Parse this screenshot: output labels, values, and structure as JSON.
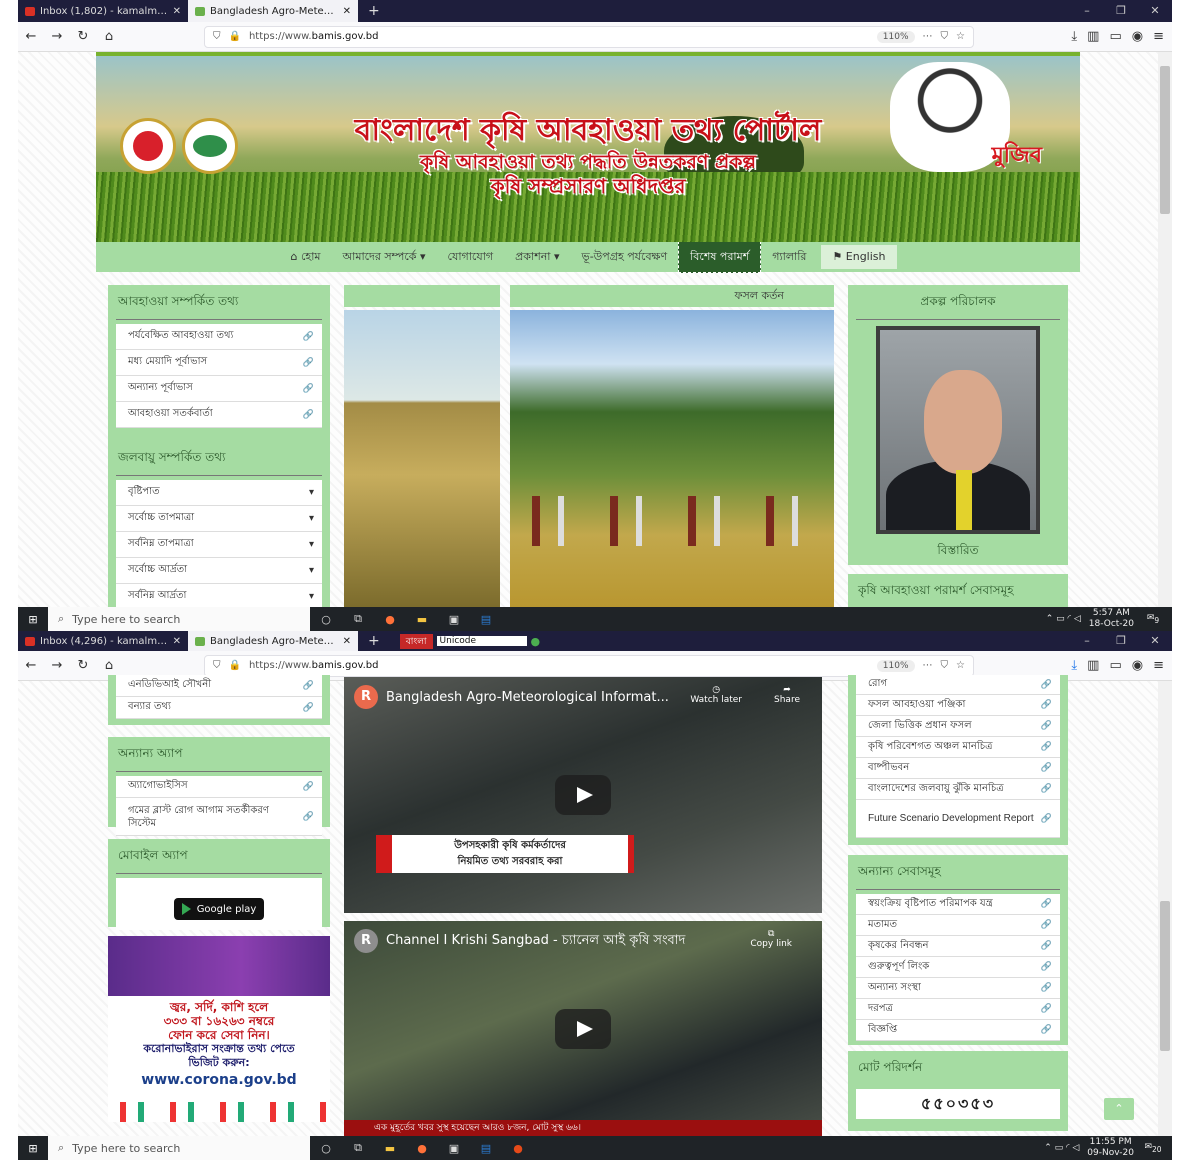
{
  "shot1": {
    "tabs": [
      {
        "title": "Inbox (1,802) - kamalmoa@gm",
        "close": "✕"
      },
      {
        "title": "Bangladesh Agro-Meteorolog",
        "close": "✕"
      }
    ],
    "new_tab": "+",
    "url_prefix": "https://www.",
    "url_domain": "bamis.gov.bd",
    "zoom": "110%",
    "banner": {
      "title": "বাংলাদেশ কৃষি আবহাওয়া তথ্য পোর্টাল",
      "subtitle1": "কৃষি আবহাওয়া তথ্য পদ্ধতি উন্নতকরণ প্রকল্প",
      "subtitle2": "কৃষি সম্প্রসারণ অধিদপ্তর",
      "mujib": "মুজিব"
    },
    "menu": [
      "হোম",
      "আমাদের সম্পর্কে",
      "যোগাযোগ",
      "প্রকাশনা",
      "ভূ-উপগ্রহ পর্যবেক্ষণ",
      "বিশেষ পরামর্শ",
      "গ্যালারি",
      "English"
    ],
    "weather_panel": {
      "title": "আবহাওয়া সম্পর্কিত তথ্য",
      "items": [
        "পর্যবেক্ষিত আবহাওয়া তথ্য",
        "মধ্য মেয়াদি পূর্বাভাস",
        "অন্যান্য পূর্বাভাস",
        "আবহাওয়া সতর্কবার্তা"
      ]
    },
    "climate_panel": {
      "title": "জলবায়ু সম্পর্কিত তথ্য",
      "items": [
        "বৃষ্টিপাত",
        "সর্বোচ্চ তাপমাত্রা",
        "সর্বনিম্ন তাপমাত্রা",
        "সর্বোচ্চ আর্দ্রতা",
        "সর্বনিম্ন আর্দ্রতা"
      ]
    },
    "slide_caption": "ফসল কর্তন",
    "director_panel": {
      "title": "প্রকল্প পরিচালক",
      "footer": "বিস্তারিত"
    },
    "advisory_title": "কৃষি আবহাওয়া পরামর্শ সেবাসমূহ",
    "taskbar": {
      "search": "Type here to search",
      "time": "5:57 AM",
      "date": "18-Oct-20",
      "notif": "9"
    }
  },
  "shot2": {
    "tabs": [
      {
        "title": "Inbox (4,296) - kamalmoa@gm",
        "close": "✕"
      },
      {
        "title": "Bangladesh Agro-Meteorolog",
        "close": "✕"
      }
    ],
    "new_tab": "+",
    "ime": {
      "label": "বাংলা",
      "font": "Unicode"
    },
    "url_prefix": "https://www.",
    "url_domain": "bamis.gov.bd",
    "zoom": "110%",
    "left_top_items": [
      "এনডিভিআই সৌখনী",
      "বন্যার তথ্য"
    ],
    "apps_panel": {
      "title": "অন্যান্য অ্যাপ",
      "items": [
        "অ্যাগোভাইসিস",
        "গমের ব্লাস্ট রোগ আগাম সতর্কীকরণ সিস্টেম"
      ]
    },
    "mobile_panel": {
      "title": "মোবাইল অ্যাপ",
      "gplay": "Google play"
    },
    "corona": {
      "line1": "জ্বর, সর্দি, কাশি হলে",
      "line2": "৩৩৩ বা ১৬২৬৩ নম্বরে",
      "line3": "ফোন করে সেবা নিন।",
      "line4": "করোনাভাইরাস সংক্রান্ত তথ্য পেতে",
      "line5": "ভিজিট করুন:",
      "url": "www.corona.gov.bd"
    },
    "video1": {
      "avatar": "R",
      "title": "Bangladesh Agro-Meteorological Informat...",
      "watch_later": "Watch later",
      "share": "Share",
      "caption1": "উপসহকারী কৃষি কর্মকর্তাদের",
      "caption2": "নিয়মিত তথ্য সরবরাহ করা"
    },
    "video2": {
      "avatar": "R",
      "title": "Channel I Krishi Sangbad - চ্যানেল আই কৃষি সংবাদ",
      "copy_link": "Copy link",
      "ticker": "এক মুহূর্তের খবর  সুস্থ হয়েছেন আরও ৮জন, মোট সুস্থ ৬৬।"
    },
    "right_top_items": [
      "রোগ",
      "ফসল আবহাওয়া পঞ্জিকা",
      "জেলা ভিত্তিক প্রধান ফসল",
      "কৃষি পরিবেশগত অঞ্চল মানচিত্র",
      "বাষ্পীভবন",
      "বাংলাদেশের জলবায়ু ঝুঁকি মানচিত্র",
      "Future Scenario Development Report"
    ],
    "services_panel": {
      "title": "অন্যান্য সেবাসমূহ",
      "items": [
        "স্বয়ংক্রিয় বৃষ্টিপাত পরিমাপক যন্ত্র",
        "মতামত",
        "কৃষকের নিবন্ধন",
        "গুরুত্বপূর্ণ লিংক",
        "অন্যান্য সংস্থা",
        "দরপত্র",
        "বিজ্ঞপ্তি"
      ]
    },
    "visitors": {
      "title": "মোট পরিদর্শন",
      "count": "৫৫০৩৫৩"
    },
    "taskbar": {
      "search": "Type here to search",
      "time": "11:55 PM",
      "date": "09-Nov-20",
      "notif": "20"
    }
  }
}
